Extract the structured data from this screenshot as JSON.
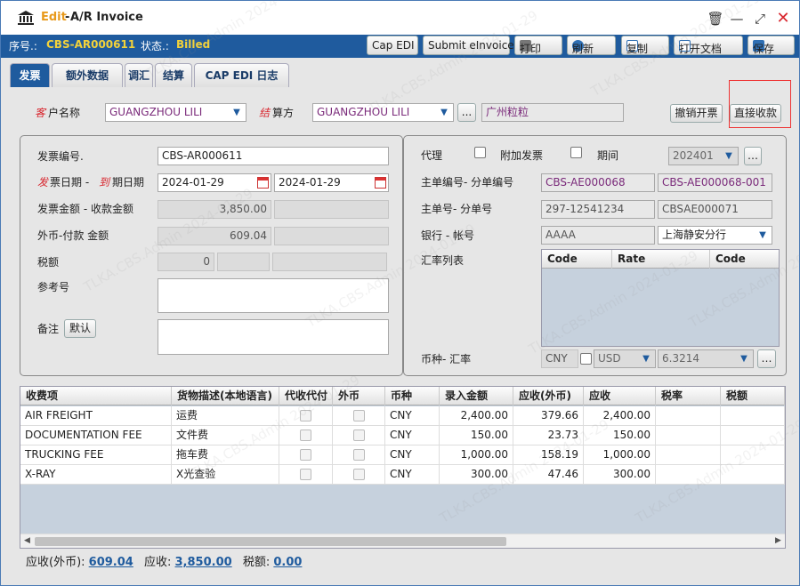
{
  "window": {
    "mode": "Edit",
    "title": "A/R Invoice"
  },
  "info": {
    "seq_label": "序号.:",
    "seq_value": "CBS-AR000611",
    "status_label": "状态.:",
    "status_value": "Billed"
  },
  "toolbar": {
    "cap_edi": "Cap EDI",
    "submit_einvoice": "Submit eInvoice",
    "print": "打印",
    "refresh": "刷新",
    "copy": "复制",
    "open_doc": "打开文档",
    "save": "保存"
  },
  "tabs": [
    "发票",
    "额外数据",
    "调汇",
    "结算",
    "CAP EDI 日志"
  ],
  "customer": {
    "label_red": "客",
    "label": "户名称",
    "value": "GUANGZHOU LILI",
    "settle_red": "结",
    "settle_label": "算方",
    "settle_value": "GUANGZHOU LILI",
    "more": "...",
    "local_name": "广州粒粒",
    "cancel_button": "撤销开票",
    "direct_receive_button": "直接收款"
  },
  "left": {
    "invoice_no_label": "发票编号.",
    "invoice_no": "CBS-AR000611",
    "date_red1": "发",
    "date_label1": "票日期 -",
    "date_red2": "到",
    "date_label2": "期日期",
    "invoice_date": "2024-01-29",
    "due_date": "2024-01-29",
    "amount_label": "发票金额 - 收款金额",
    "amount": "3,850.00",
    "fc_label": "外币-付款 金额",
    "fc_amount": "609.04",
    "tax_label": "税额",
    "tax_value": "0",
    "ref_label": "参考号",
    "remark_label": "备注",
    "default_button": "默认"
  },
  "right": {
    "agent_label": "代理",
    "extra_invoice_label": "附加发票",
    "period_label": "期间",
    "period_value": "202401",
    "master_label": "主单编号- 分单编号",
    "master_no": "CBS-AE000068",
    "house_no": "CBS-AE000068-001",
    "mawb_label": "主单号- 分单号",
    "mawb": "297-12541234",
    "hawb": "CBSAE000071",
    "bank_label": "银行 - 帐号",
    "bank": "AAAA",
    "account": "上海静安分行",
    "rate_list_label": "汇率列表",
    "rate_headers": [
      "Code",
      "Rate",
      "Code"
    ],
    "currency_label": "币种- 汇率",
    "currency": "CNY",
    "fc_currency": "USD",
    "exchange_rate": "6.3214"
  },
  "grid": {
    "headers": [
      "收费项",
      "货物描述(本地语言)",
      "代收代付",
      "外币",
      "币种",
      "录入金额",
      "应收(外币)",
      "应收",
      "税率",
      "税额"
    ],
    "rows": [
      {
        "item": "AIR FREIGHT",
        "desc": "运费",
        "currency": "CNY",
        "amount": "2,400.00",
        "fc": "379.66",
        "receivable": "2,400.00"
      },
      {
        "item": "DOCUMENTATION FEE",
        "desc": "文件费",
        "currency": "CNY",
        "amount": "150.00",
        "fc": "23.73",
        "receivable": "150.00"
      },
      {
        "item": "TRUCKING FEE",
        "desc": "拖车费",
        "currency": "CNY",
        "amount": "1,000.00",
        "fc": "158.19",
        "receivable": "1,000.00"
      },
      {
        "item": "X-RAY",
        "desc": "X光查验",
        "currency": "CNY",
        "amount": "300.00",
        "fc": "47.46",
        "receivable": "300.00"
      }
    ]
  },
  "footer": {
    "fc_label": "应收(外币):",
    "fc_value": "609.04",
    "recv_label": "应收:",
    "recv_value": "3,850.00",
    "tax_label": "税额:",
    "tax_value": "0.00"
  },
  "watermark": "TLKA.CBS.Admin 2024-01-29",
  "colors": {
    "brand_blue": "#1f5b9e",
    "status_yellow": "#f3d23a",
    "required_red": "#d8262e",
    "value_purple": "#7a2a7a"
  }
}
